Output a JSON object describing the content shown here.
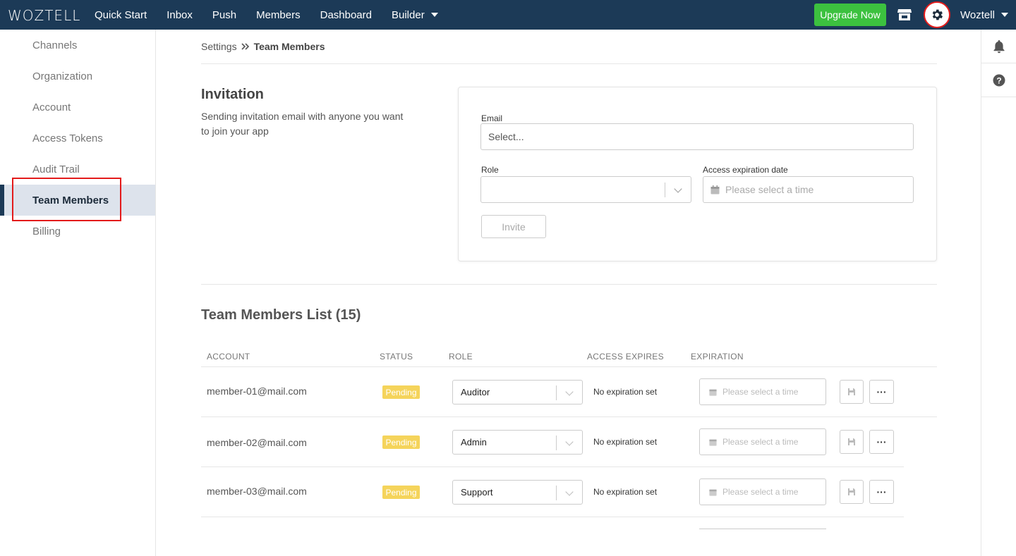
{
  "app": {
    "logo": "WOZTELL"
  },
  "nav": {
    "items": [
      "Quick Start",
      "Inbox",
      "Push",
      "Members",
      "Dashboard",
      "Builder"
    ],
    "upgrade_label": "Upgrade Now",
    "user_name": "Woztell"
  },
  "sidebar": {
    "items": [
      {
        "label": "Channels"
      },
      {
        "label": "Organization"
      },
      {
        "label": "Account"
      },
      {
        "label": "Access Tokens"
      },
      {
        "label": "Audit Trail"
      },
      {
        "label": "Team Members"
      },
      {
        "label": "Billing"
      }
    ],
    "active": "Team Members"
  },
  "breadcrumb": {
    "root": "Settings",
    "current": "Team Members"
  },
  "invitation": {
    "title": "Invitation",
    "description": "Sending invitation email with anyone you want to join your app",
    "email_label": "Email",
    "email_placeholder": "Select...",
    "role_label": "Role",
    "role_value": "",
    "expiration_label": "Access expiration date",
    "expiration_placeholder": "Please select a time",
    "invite_label": "Invite"
  },
  "team_list": {
    "title": "Team Members List (15)",
    "columns": [
      "ACCOUNT",
      "STATUS",
      "ROLE",
      "ACCESS EXPIRES",
      "EXPIRATION"
    ],
    "rows": [
      {
        "account": "member-01@mail.com",
        "status": "Pending",
        "role": "Auditor",
        "access_expires": "No expiration set",
        "expiration_placeholder": "Please select a time",
        "more_label": "···"
      },
      {
        "account": "member-02@mail.com",
        "status": "Pending",
        "role": "Admin",
        "access_expires": "No expiration set",
        "expiration_placeholder": "Please select a time",
        "more_label": "···"
      },
      {
        "account": "member-03@mail.com",
        "status": "Pending",
        "role": "Support",
        "access_expires": "No expiration set",
        "expiration_placeholder": "Please select a time",
        "more_label": "···"
      }
    ]
  },
  "colors": {
    "navbar": "#1c3a57",
    "upgrade": "#3cc13f",
    "pending_badge": "#f5d45b",
    "highlight": "#e31b1b"
  },
  "icons": [
    "store-icon",
    "gear-icon",
    "bell-icon",
    "help-icon",
    "calendar-icon",
    "save-icon",
    "chevron-down-icon"
  ]
}
